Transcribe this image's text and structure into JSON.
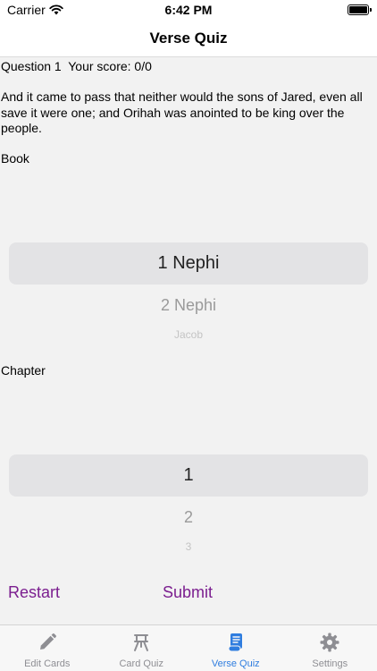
{
  "status_bar": {
    "carrier": "Carrier",
    "time": "6:42 PM"
  },
  "nav": {
    "title": "Verse Quiz"
  },
  "quiz": {
    "question_line": "Question 1  Your score: 0/0",
    "verse": "And it came to pass that neither would the sons of Jared, even all save it were one; and Orihah was anointed to be king over the people."
  },
  "book_picker": {
    "label": "Book",
    "selected": "1 Nephi",
    "next": "2 Nephi",
    "after": "Jacob"
  },
  "chapter_picker": {
    "label": "Chapter",
    "selected": "1",
    "next": "2",
    "after": "3"
  },
  "actions": {
    "restart": "Restart",
    "submit": "Submit"
  },
  "tabs": [
    {
      "label": "Edit Cards",
      "icon": "pencil-icon"
    },
    {
      "label": "Card Quiz",
      "icon": "easel-icon"
    },
    {
      "label": "Verse Quiz",
      "icon": "scroll-icon",
      "active": true
    },
    {
      "label": "Settings",
      "icon": "gear-icon"
    }
  ],
  "colors": {
    "accent": "#7b1e8f",
    "tab_active": "#2f7ddf",
    "tab_inactive": "#8e8e93"
  }
}
